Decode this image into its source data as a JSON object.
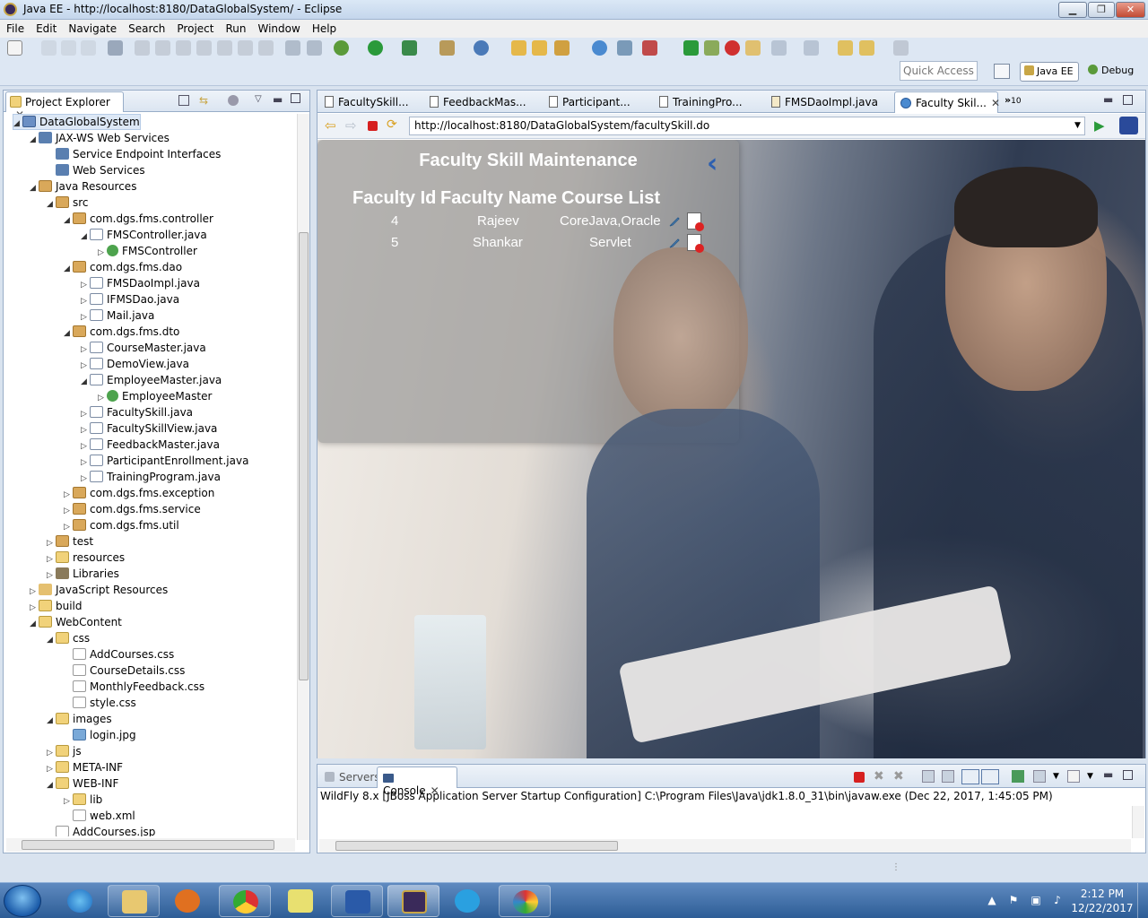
{
  "window": {
    "title": "Java EE - http://localhost:8180/DataGlobalSystem/ - Eclipse",
    "min": "▁",
    "max": "❐",
    "close": "✕"
  },
  "menu": [
    "File",
    "Edit",
    "Navigate",
    "Search",
    "Project",
    "Run",
    "Window",
    "Help"
  ],
  "toolbar": {
    "quick_access_placeholder": "Quick Access",
    "perspective_javaee": "Java EE",
    "perspective_debug": "Debug"
  },
  "project_explorer": {
    "tab_label": "Project Explorer",
    "tree": [
      {
        "label": "DataGlobalSystem",
        "indent": 0,
        "arrow": "◢",
        "icon": "ic-project",
        "selected": true
      },
      {
        "label": "JAX-WS Web Services",
        "indent": 1,
        "arrow": "◢",
        "icon": "ic-ws"
      },
      {
        "label": "Service Endpoint Interfaces",
        "indent": 2,
        "arrow": "",
        "icon": "ic-ws"
      },
      {
        "label": "Web Services",
        "indent": 2,
        "arrow": "",
        "icon": "ic-ws"
      },
      {
        "label": "Java Resources",
        "indent": 1,
        "arrow": "◢",
        "icon": "ic-pkg"
      },
      {
        "label": "src",
        "indent": 2,
        "arrow": "◢",
        "icon": "ic-pkg"
      },
      {
        "label": "com.dgs.fms.controller",
        "indent": 3,
        "arrow": "◢",
        "icon": "ic-pkg"
      },
      {
        "label": "FMSController.java",
        "indent": 4,
        "arrow": "◢",
        "icon": "ic-java"
      },
      {
        "label": "FMSController",
        "indent": 5,
        "arrow": "▷",
        "icon": "ic-class"
      },
      {
        "label": "com.dgs.fms.dao",
        "indent": 3,
        "arrow": "◢",
        "icon": "ic-pkg"
      },
      {
        "label": "FMSDaoImpl.java",
        "indent": 4,
        "arrow": "▷",
        "icon": "ic-java"
      },
      {
        "label": "IFMSDao.java",
        "indent": 4,
        "arrow": "▷",
        "icon": "ic-java"
      },
      {
        "label": "Mail.java",
        "indent": 4,
        "arrow": "▷",
        "icon": "ic-java"
      },
      {
        "label": "com.dgs.fms.dto",
        "indent": 3,
        "arrow": "◢",
        "icon": "ic-pkg"
      },
      {
        "label": "CourseMaster.java",
        "indent": 4,
        "arrow": "▷",
        "icon": "ic-java"
      },
      {
        "label": "DemoView.java",
        "indent": 4,
        "arrow": "▷",
        "icon": "ic-java"
      },
      {
        "label": "EmployeeMaster.java",
        "indent": 4,
        "arrow": "◢",
        "icon": "ic-java"
      },
      {
        "label": "EmployeeMaster",
        "indent": 5,
        "arrow": "▷",
        "icon": "ic-class"
      },
      {
        "label": "FacultySkill.java",
        "indent": 4,
        "arrow": "▷",
        "icon": "ic-java"
      },
      {
        "label": "FacultySkillView.java",
        "indent": 4,
        "arrow": "▷",
        "icon": "ic-java"
      },
      {
        "label": "FeedbackMaster.java",
        "indent": 4,
        "arrow": "▷",
        "icon": "ic-java"
      },
      {
        "label": "ParticipantEnrollment.java",
        "indent": 4,
        "arrow": "▷",
        "icon": "ic-java"
      },
      {
        "label": "TrainingProgram.java",
        "indent": 4,
        "arrow": "▷",
        "icon": "ic-java"
      },
      {
        "label": "com.dgs.fms.exception",
        "indent": 3,
        "arrow": "▷",
        "icon": "ic-pkg"
      },
      {
        "label": "com.dgs.fms.service",
        "indent": 3,
        "arrow": "▷",
        "icon": "ic-pkg"
      },
      {
        "label": "com.dgs.fms.util",
        "indent": 3,
        "arrow": "▷",
        "icon": "ic-pkg"
      },
      {
        "label": "test",
        "indent": 2,
        "arrow": "▷",
        "icon": "ic-pkg"
      },
      {
        "label": "resources",
        "indent": 2,
        "arrow": "▷",
        "icon": "ic-folder"
      },
      {
        "label": "Libraries",
        "indent": 2,
        "arrow": "▷",
        "icon": "ic-lib"
      },
      {
        "label": "JavaScript Resources",
        "indent": 1,
        "arrow": "▷",
        "icon": "ic-js"
      },
      {
        "label": "build",
        "indent": 1,
        "arrow": "▷",
        "icon": "ic-folder"
      },
      {
        "label": "WebContent",
        "indent": 1,
        "arrow": "◢",
        "icon": "ic-folder"
      },
      {
        "label": "css",
        "indent": 2,
        "arrow": "◢",
        "icon": "ic-folder"
      },
      {
        "label": "AddCourses.css",
        "indent": 3,
        "arrow": "",
        "icon": "ic-css"
      },
      {
        "label": "CourseDetails.css",
        "indent": 3,
        "arrow": "",
        "icon": "ic-css"
      },
      {
        "label": "MonthlyFeedback.css",
        "indent": 3,
        "arrow": "",
        "icon": "ic-css"
      },
      {
        "label": "style.css",
        "indent": 3,
        "arrow": "",
        "icon": "ic-css"
      },
      {
        "label": "images",
        "indent": 2,
        "arrow": "◢",
        "icon": "ic-folder"
      },
      {
        "label": "login.jpg",
        "indent": 3,
        "arrow": "",
        "icon": "ic-img"
      },
      {
        "label": "js",
        "indent": 2,
        "arrow": "▷",
        "icon": "ic-folder"
      },
      {
        "label": "META-INF",
        "indent": 2,
        "arrow": "▷",
        "icon": "ic-folder"
      },
      {
        "label": "WEB-INF",
        "indent": 2,
        "arrow": "◢",
        "icon": "ic-folder"
      },
      {
        "label": "lib",
        "indent": 3,
        "arrow": "▷",
        "icon": "ic-folder"
      },
      {
        "label": "web.xml",
        "indent": 3,
        "arrow": "",
        "icon": "ic-css"
      },
      {
        "label": "AddCourses.jsp",
        "indent": 2,
        "arrow": "",
        "icon": "ic-css"
      }
    ]
  },
  "editor": {
    "tabs": [
      {
        "label": "FacultySkill...",
        "active": false
      },
      {
        "label": "FeedbackMas...",
        "active": false
      },
      {
        "label": "Participant...",
        "active": false
      },
      {
        "label": "TrainingPro...",
        "active": false
      },
      {
        "label": "FMSDaoImpl.java",
        "active": false
      },
      {
        "label": "Faculty Skil...",
        "active": true
      }
    ],
    "overflow_count": "10",
    "url": "http://localhost:8180/DataGlobalSystem/facultySkill.do"
  },
  "page": {
    "title": "Faculty Skill Maintenance",
    "back_glyph": "‹",
    "headers": [
      "Faculty Id",
      "Faculty Name",
      "Course List"
    ],
    "rows": [
      {
        "id": "4",
        "name": "Rajeev",
        "courses": "CoreJava,Oracle"
      },
      {
        "id": "5",
        "name": "Shankar",
        "courses": "Servlet"
      }
    ]
  },
  "console": {
    "tab_servers": "Servers",
    "tab_console": "Console",
    "line": "WildFly 8.x [JBoss Application Server Startup Configuration] C:\\Program Files\\Java\\jdk1.8.0_31\\bin\\javaw.exe (Dec 22, 2017, 1:45:05 PM)"
  },
  "taskbar": {
    "time": "2:12 PM",
    "date": "12/22/2017",
    "apps": [
      "internet-explorer",
      "file-explorer",
      "media-player",
      "chrome",
      "sticky-notes",
      "word",
      "eclipse-javaee",
      "skype",
      "paint"
    ]
  },
  "colors": {
    "accent": "#2d5fb0",
    "panel_border": "#98adc8",
    "taskbar": "#2d5d96"
  }
}
